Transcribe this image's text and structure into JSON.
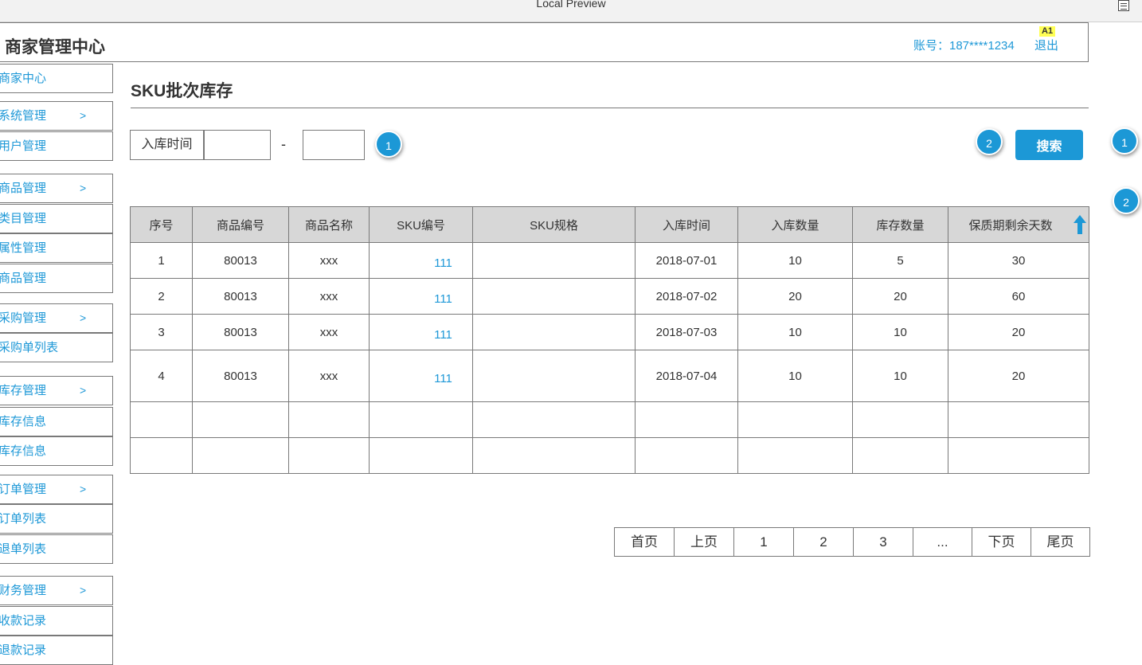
{
  "window": {
    "title": "Local Preview"
  },
  "header": {
    "brand": "商家管理中心",
    "account": "账号：187****1234",
    "logout": "退出",
    "badge": "A1"
  },
  "sidebar": {
    "items": [
      {
        "label": "商家中心",
        "chevron": ""
      },
      {
        "label": "系统管理",
        "chevron": ">"
      },
      {
        "label": "用户管理",
        "chevron": ""
      },
      {
        "label": "商品管理",
        "chevron": ">"
      },
      {
        "label": "类目管理",
        "chevron": ""
      },
      {
        "label": "属性管理",
        "chevron": ""
      },
      {
        "label": "商品管理",
        "chevron": ""
      },
      {
        "label": "采购管理",
        "chevron": ">"
      },
      {
        "label": "采购单列表",
        "chevron": ""
      },
      {
        "label": "库存管理",
        "chevron": ">"
      },
      {
        "label": "库存信息",
        "chevron": ""
      },
      {
        "label": "库存信息",
        "chevron": ""
      },
      {
        "label": "订单管理",
        "chevron": ">"
      },
      {
        "label": "订单列表",
        "chevron": ""
      },
      {
        "label": "退单列表",
        "chevron": ""
      },
      {
        "label": "财务管理",
        "chevron": ">"
      },
      {
        "label": "收款记录",
        "chevron": ""
      },
      {
        "label": "退款记录",
        "chevron": ""
      }
    ]
  },
  "main": {
    "title": "SKU批次库存",
    "filter": {
      "label": "入库时间",
      "start_value": "",
      "end_value": "",
      "separator": "-"
    },
    "search_label": "搜索",
    "markers": [
      "1",
      "2",
      "1",
      "2"
    ],
    "table": {
      "headers": [
        "序号",
        "商品编号",
        "商品名称",
        "SKU编号",
        "SKU规格",
        "入库时间",
        "入库数量",
        "库存数量",
        "保质期剩余天数"
      ],
      "rows": [
        [
          "1",
          "80013",
          "xxx",
          "111",
          "",
          "2018-07-01",
          "10",
          "5",
          "30"
        ],
        [
          "2",
          "80013",
          "xxx",
          "111",
          "",
          "2018-07-02",
          "20",
          "20",
          "60"
        ],
        [
          "3",
          "80013",
          "xxx",
          "111",
          "",
          "2018-07-03",
          "10",
          "10",
          "20"
        ],
        [
          "4",
          "80013",
          "xxx",
          "111",
          "",
          "2018-07-04",
          "10",
          "10",
          "20"
        ],
        [
          "",
          "",
          "",
          "",
          "",
          "",
          "",
          "",
          ""
        ],
        [
          "",
          "",
          "",
          "",
          "",
          "",
          "",
          "",
          ""
        ]
      ]
    },
    "pagination": [
      "首页",
      "上页",
      "1",
      "2",
      "3",
      "...",
      "下页",
      "尾页"
    ]
  },
  "colors": {
    "accent": "#1c98d6",
    "link": "#1e98d7",
    "header_bg": "#d7d7d7",
    "border": "#797979"
  },
  "icons": {
    "sort": "arrow-up-icon",
    "doc": "document-icon"
  }
}
